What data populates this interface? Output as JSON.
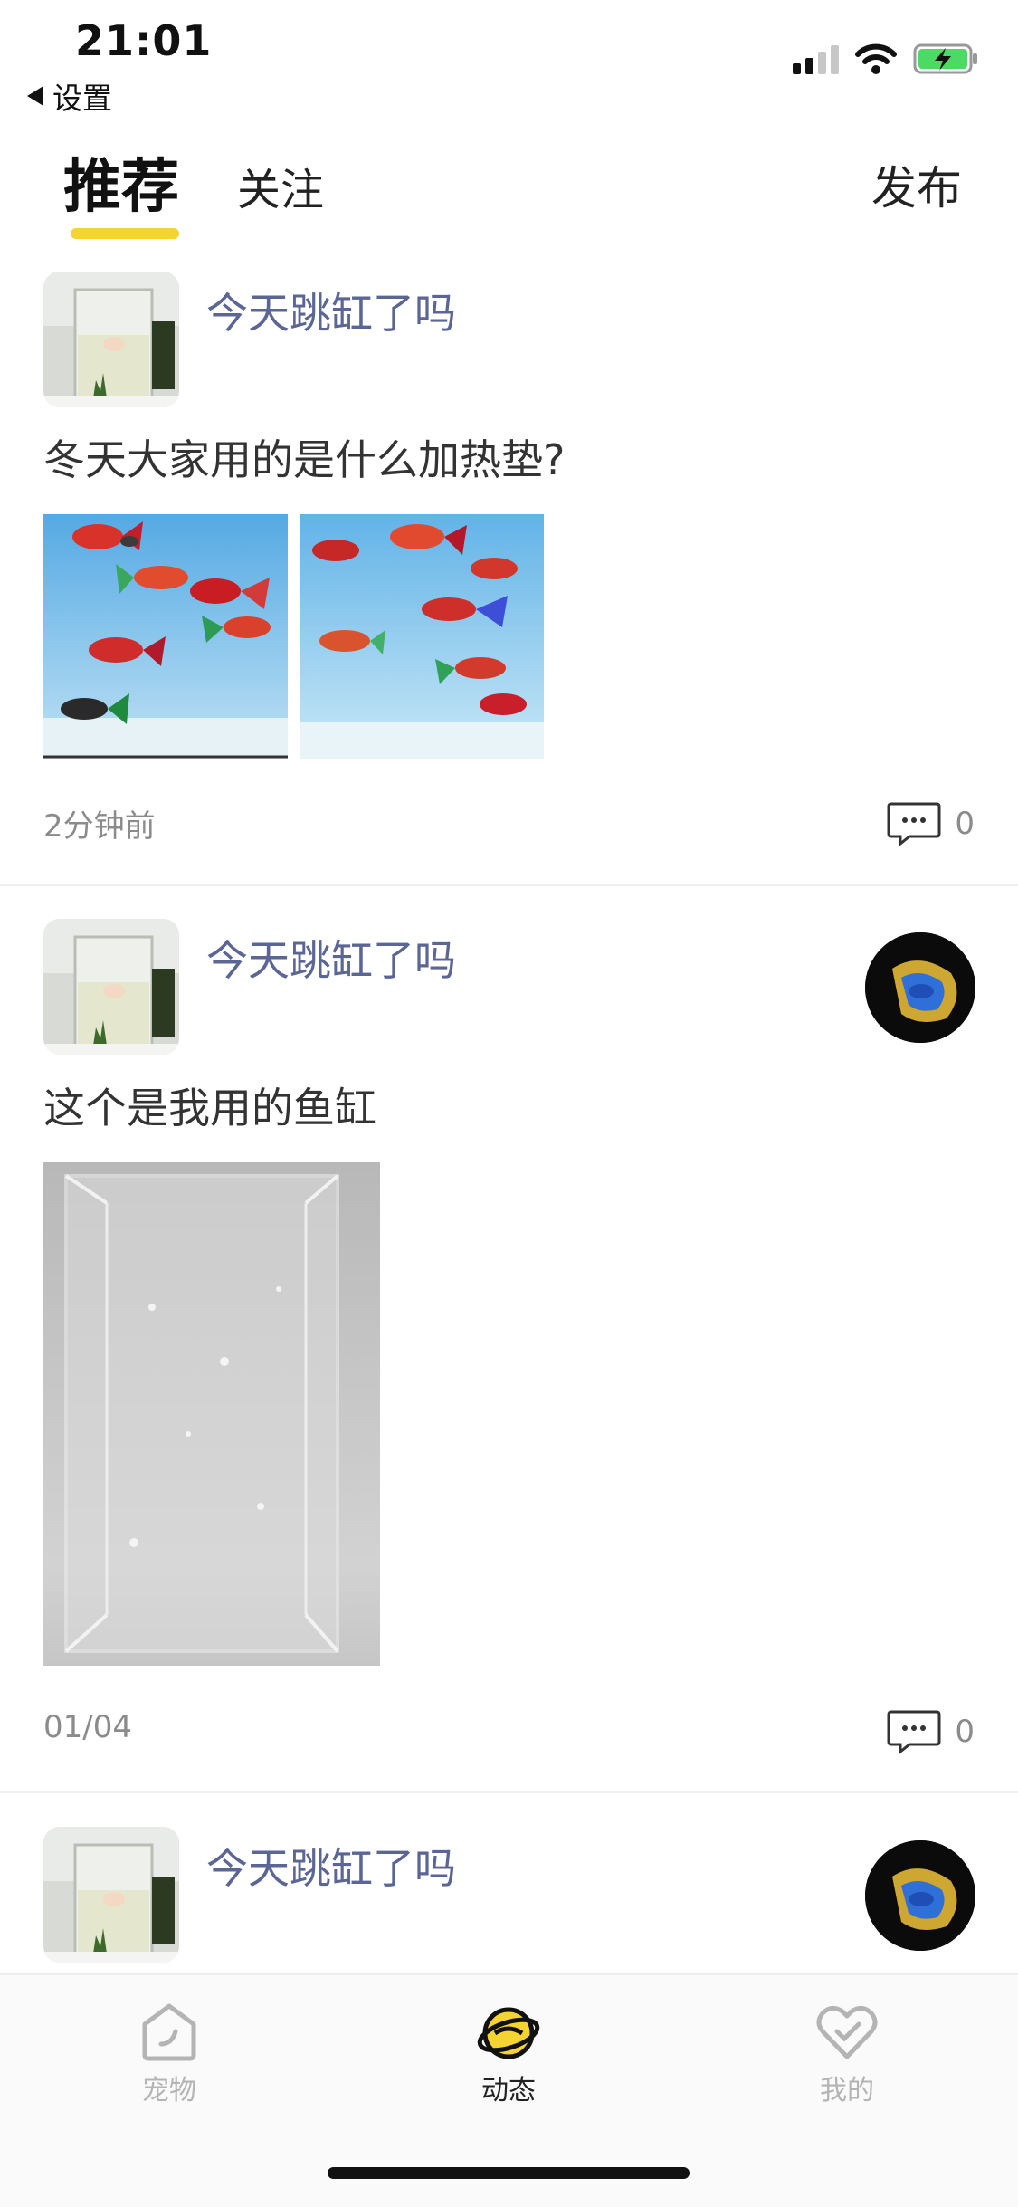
{
  "status_bar": {
    "time": "21:01",
    "back_label": "设置"
  },
  "header": {
    "tabs": [
      {
        "label": "推荐",
        "active": true
      },
      {
        "label": "关注",
        "active": false
      }
    ],
    "publish_label": "发布"
  },
  "posts": [
    {
      "username": "今天跳缸了吗",
      "text": "冬天大家用的是什么加热垫?",
      "time": "2分钟前",
      "comment_count": "0",
      "images": [
        "betta-fish-tank-photo",
        "betta-fish-tank-photo"
      ]
    },
    {
      "username": "今天跳缸了吗",
      "text": "这个是我用的鱼缸",
      "time": "01/04",
      "comment_count": "0",
      "images": [
        "empty-acrylic-tank-photo"
      ]
    },
    {
      "username": "今天跳缸了吗"
    }
  ],
  "bottom_nav": {
    "items": [
      {
        "label": "宠物",
        "icon": "pet-tab-icon",
        "active": false
      },
      {
        "label": "动态",
        "icon": "feed-tab-icon",
        "active": true
      },
      {
        "label": "我的",
        "icon": "heart-tab-icon",
        "active": false
      }
    ]
  },
  "colors": {
    "accent_yellow": "#f5d330",
    "username_blue": "#5b6695",
    "meta_gray": "#8b8b8b"
  }
}
